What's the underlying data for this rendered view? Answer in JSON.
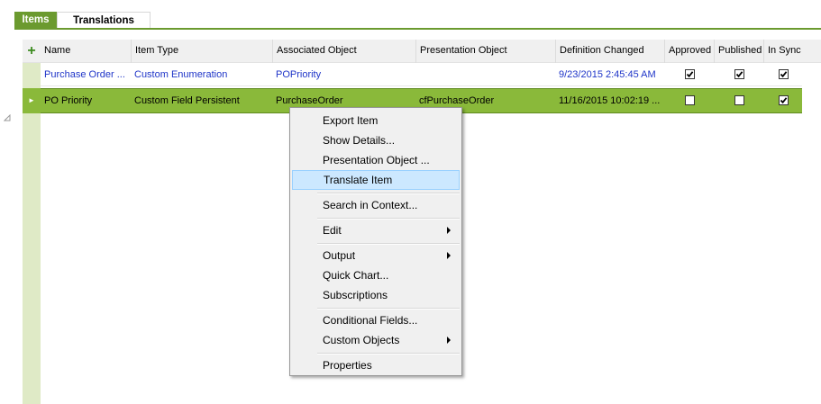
{
  "tabs": [
    {
      "label": "Items"
    },
    {
      "label": "Translations"
    }
  ],
  "grid": {
    "add_symbol": "+",
    "columns": [
      "Name",
      "Item Type",
      "Associated Object",
      "Presentation Object",
      "Definition Changed",
      "Approved",
      "Published",
      "In Sync"
    ],
    "rows": [
      {
        "name": "Purchase Order ...",
        "item_type": "Custom Enumeration",
        "associated_object": "POPriority",
        "presentation_object": "",
        "definition_changed": "9/23/2015 2:45:45 AM",
        "approved": true,
        "published": true,
        "in_sync": true
      },
      {
        "name": "PO Priority",
        "item_type": "Custom Field Persistent",
        "associated_object": "PurchaseOrder",
        "presentation_object": "cfPurchaseOrder",
        "definition_changed": "11/16/2015 10:02:19 ...",
        "approved": false,
        "published": false,
        "in_sync": true
      }
    ],
    "selected_row_indicator": "►"
  },
  "context_menu": {
    "items": {
      "export_item": "Export Item",
      "show_details": "Show Details...",
      "presentation_object": "Presentation Object ...",
      "translate_item": "Translate Item",
      "search_in_context": "Search in Context...",
      "edit": "Edit",
      "output": "Output",
      "quick_chart": "Quick Chart...",
      "subscriptions": "Subscriptions",
      "conditional_fields": "Conditional Fields...",
      "custom_objects": "Custom Objects",
      "properties": "Properties"
    },
    "highlighted": "Translate Item"
  },
  "colors": {
    "accent_green": "#6b9a2f",
    "selected_row": "#8ab93a",
    "link_blue": "#1f35c8",
    "menu_highlight": "#cce8ff"
  }
}
